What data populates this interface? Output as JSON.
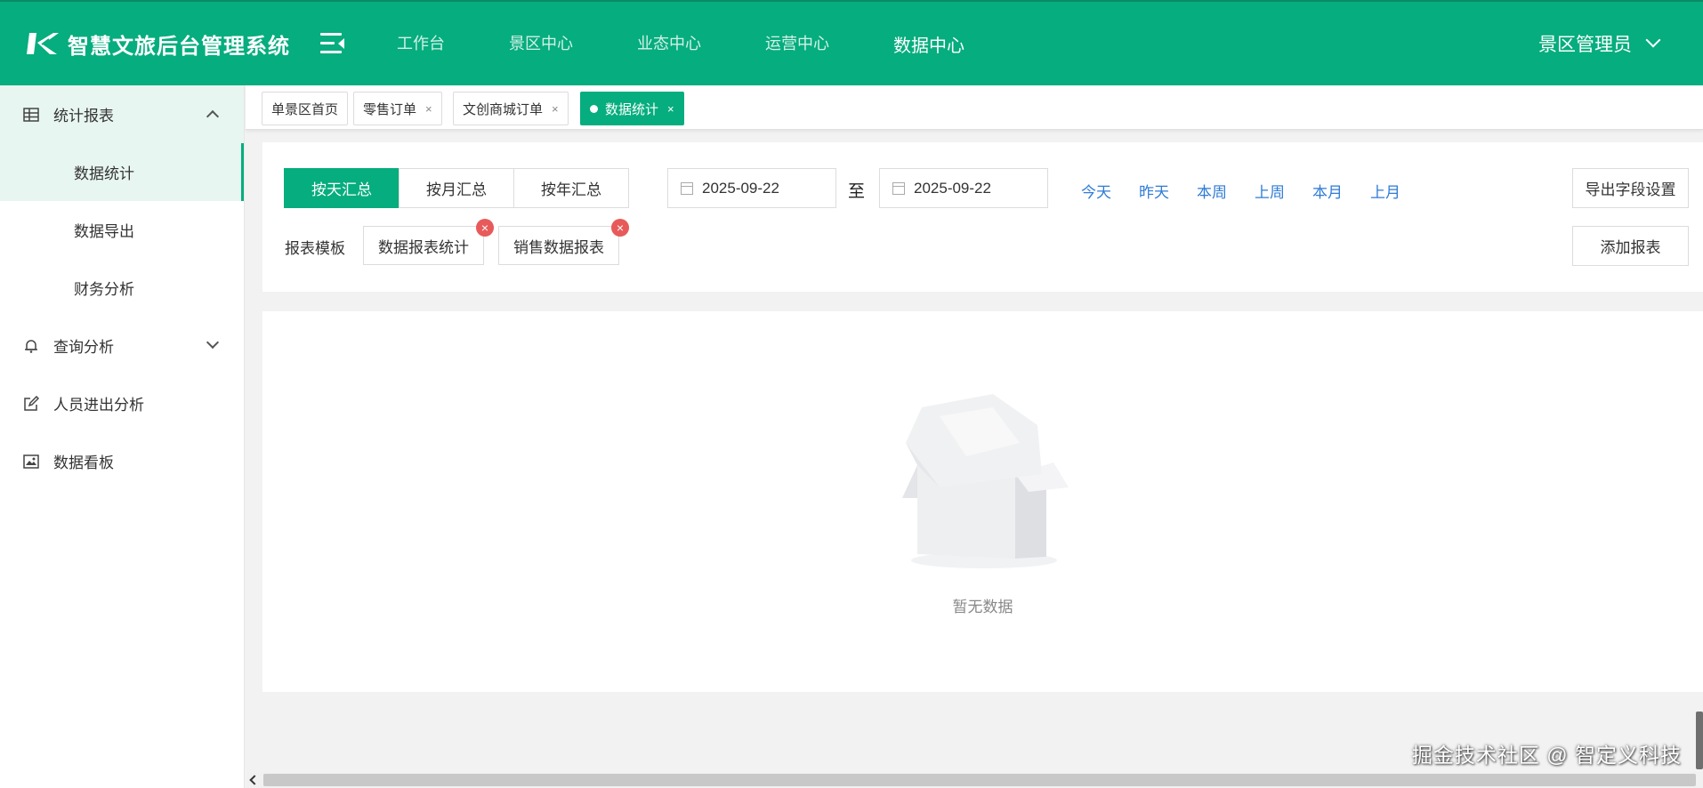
{
  "header": {
    "title": "智慧文旅后台管理系统",
    "nav": [
      "工作台",
      "景区中心",
      "业态中心",
      "运营中心",
      "数据中心"
    ],
    "active_nav": "数据中心",
    "user": "景区管理员"
  },
  "sidebar": {
    "groups": [
      {
        "label": "统计报表",
        "icon": "table-icon",
        "open": true,
        "items": [
          "数据统计",
          "数据导出",
          "财务分析"
        ],
        "active_item": "数据统计"
      },
      {
        "label": "查询分析",
        "icon": "bell-icon",
        "open": false
      },
      {
        "label": "人员进出分析",
        "icon": "edit-icon"
      },
      {
        "label": "数据看板",
        "icon": "image-icon"
      }
    ]
  },
  "tabs": [
    {
      "label": "单景区首页",
      "closable": false
    },
    {
      "label": "零售订单",
      "closable": true
    },
    {
      "label": "文创商城订单",
      "closable": true
    },
    {
      "label": "数据统计",
      "closable": true,
      "active": true
    }
  ],
  "tab_close": "×",
  "filters": {
    "segments": [
      "按天汇总",
      "按月汇总",
      "按年汇总"
    ],
    "active_segment": "按天汇总",
    "start_date": "2025-09-22",
    "to_label": "至",
    "end_date": "2025-09-22",
    "quick": [
      "今天",
      "昨天",
      "本周",
      "上周",
      "本月",
      "上月"
    ],
    "export_settings": "导出字段设置",
    "add_report": "添加报表",
    "template_label": "报表模板",
    "templates": [
      "数据报表统计",
      "销售数据报表"
    ],
    "delete_glyph": "×"
  },
  "empty": {
    "text": "暂无数据"
  },
  "watermark": "掘金技术社区 @ 智定义科技",
  "colors": {
    "primary": "#06ad7e",
    "link": "#2e7bd6",
    "danger": "#e85a5a"
  }
}
